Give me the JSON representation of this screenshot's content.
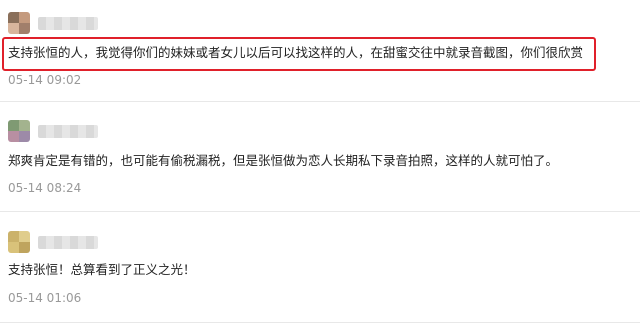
{
  "comments": [
    {
      "text": "支持张恒的人，我觉得你们的妹妹或者女儿以后可以找这样的人，在甜蜜交往中就录音截图，你们很欣赏",
      "time": "05-14 09:02",
      "highlighted": true,
      "avatar_colors": [
        "#8a6f5a",
        "#c49a7e",
        "#d8b59c",
        "#a17f6b"
      ]
    },
    {
      "text": "郑爽肯定是有错的，也可能有偷税漏税，但是张恒做为恋人长期私下录音拍照，这样的人就可怕了。",
      "time": "05-14 08:24",
      "highlighted": false,
      "avatar_colors": [
        "#7f9a73",
        "#a3b38e",
        "#b88fa2",
        "#9d8aa8"
      ]
    },
    {
      "text": "支持张恒！总算看到了正义之光！",
      "time": "05-14 01:06",
      "highlighted": false,
      "avatar_colors": [
        "#cbb26a",
        "#e0cd8c",
        "#d9c27a",
        "#bfa45e"
      ]
    }
  ],
  "highlight_color": "#e0202a"
}
